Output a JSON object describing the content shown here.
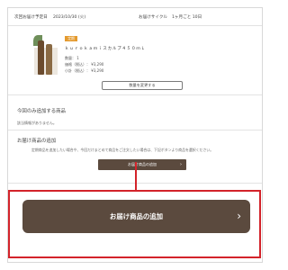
{
  "delivery_info": {
    "next_date_label": "次回お届け予定日",
    "next_date_value": "2023/10/30 (火)",
    "cycle_label": "お届けサイクル",
    "cycle_value": "1ヶ月ごと 10日"
  },
  "product": {
    "tag": "定期",
    "name": "ｋｕｒｏｋａｍｉスカルプ４５０ｍＬ",
    "quantity_label": "数量：",
    "quantity_value": "1",
    "price_label": "価格（税込）：",
    "price_value": "¥3,290",
    "subtotal_label": "小計（税込）：",
    "subtotal_value": "¥3,290",
    "change_button": "数量を変更する"
  },
  "one_time": {
    "title": "今回のみ追加する商品",
    "empty_message": "該当情報がありません。"
  },
  "add_products": {
    "title": "お届け商品の追加",
    "note": "定期商品を追加したい場合や、今回だけまとめて商品をご注文したい場合は、下記ボタンより商品を選択ください。",
    "small_button": "お届け商品の追加",
    "big_button": "お届け商品の追加"
  },
  "colors": {
    "button_brown": "#5b4a3e",
    "highlight_red": "#d3232a",
    "tag_orange": "#e49a2e"
  }
}
